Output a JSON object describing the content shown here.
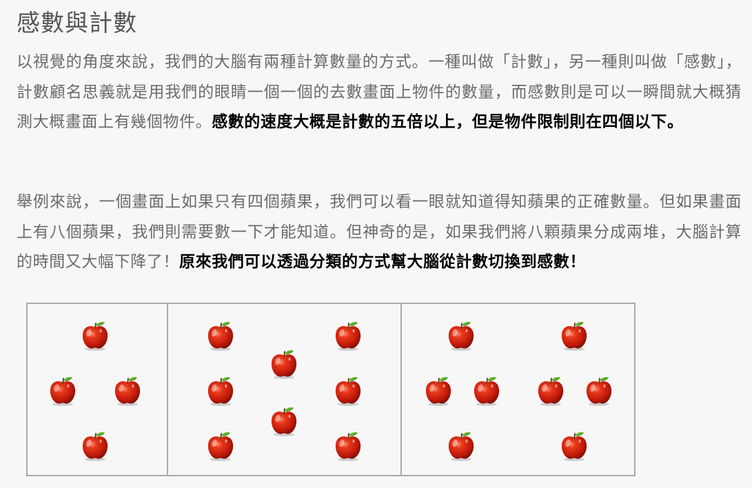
{
  "article": {
    "title": "感數與計數",
    "paragraph1": {
      "normal": "以視覺的角度來說，我們的大腦有兩種計算數量的方式。一種叫做「計數」，另一種則叫做「感數」，計數顧名思義就是用我們的眼睛一個一個的去數畫面上物件的數量，而感數則是可以一瞬間就大概猜測大概畫面上有幾個物件。",
      "bold": "感數的速度大概是計數的五倍以上，但是物件限制則在四個以下。"
    },
    "paragraph2": {
      "normal": "舉例來說，一個畫面上如果只有四個蘋果，我們可以看一眼就知道得知蘋果的正確數量。但如果畫面上有八個蘋果，我們則需要數一下才能知道。但神奇的是，如果我們將八顆蘋果分成兩堆，大腦計算的時間又大幅下降了！",
      "bold": "原來我們可以透過分類的方式幫大腦從計數切換到感數！"
    }
  },
  "figure": {
    "panels": [
      {
        "name": "four-apples",
        "apple_count": 4
      },
      {
        "name": "eight-apples",
        "apple_count": 8
      },
      {
        "name": "eight-apples-grouped",
        "apple_count": 8,
        "groups": 2
      }
    ],
    "icon": "apple-icon",
    "colors": {
      "apple_red": "#c81e0e",
      "leaf_green": "#3e9a1f",
      "border": "#a9a9a9"
    }
  }
}
